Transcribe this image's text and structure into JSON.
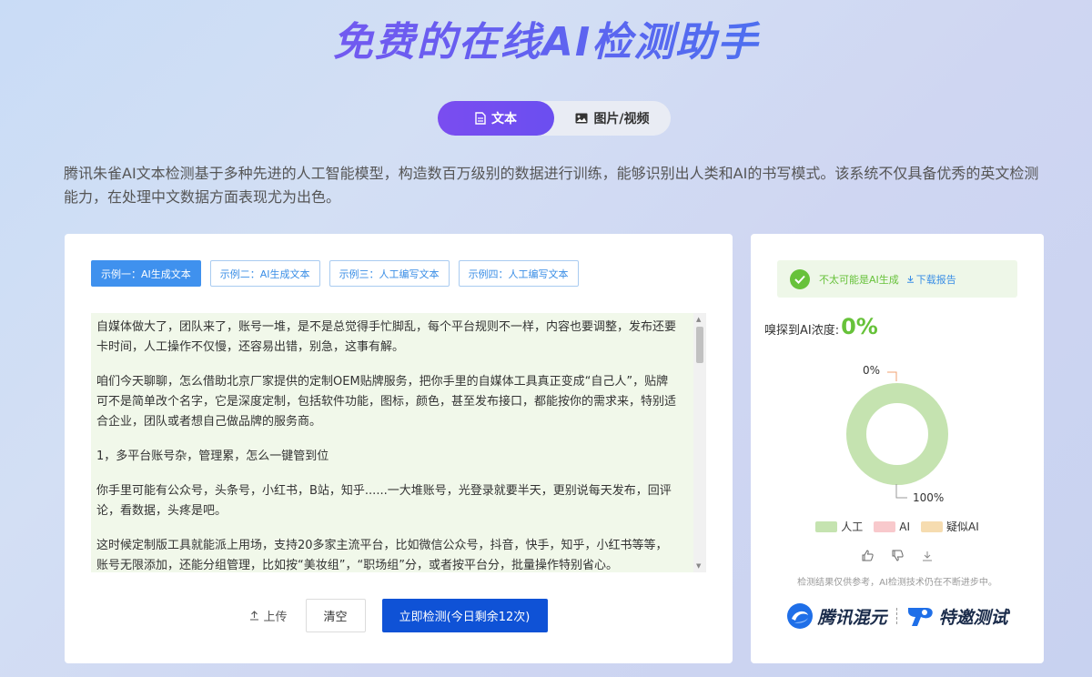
{
  "page_title": "免费的在线AI检测助手",
  "tabs": [
    {
      "label": "文本",
      "icon": "document-icon",
      "active": true
    },
    {
      "label": "图片/视频",
      "icon": "image-icon",
      "active": false
    }
  ],
  "description": "腾讯朱雀AI文本检测基于多种先进的人工智能模型，构造数百万级别的数据进行训练，能够识别出人类和AI的书写模式。该系统不仅具备优秀的英文检测能力，在处理中文数据方面表现尤为出色。",
  "examples": [
    {
      "label": "示例一：AI生成文本",
      "active": true
    },
    {
      "label": "示例二：AI生成文本",
      "active": false
    },
    {
      "label": "示例三：人工编写文本",
      "active": false
    },
    {
      "label": "示例四：人工编写文本",
      "active": false
    }
  ],
  "text_paragraphs": [
    "自媒体做大了，团队来了，账号一堆，是不是总觉得手忙脚乱，每个平台规则不一样，内容也要调整，发布还要卡时间，人工操作不仅慢，还容易出错，别急，这事有解。",
    "咱们今天聊聊，怎么借助北京厂家提供的定制OEM贴牌服务，把你手里的自媒体工具真正变成“自己人”，贴牌可不是简单改个名字，它是深度定制，包括软件功能，图标，颜色，甚至发布接口，都能按你的需求来，特别适合企业，团队或者想自己做品牌的服务商。",
    "1，多平台账号杂，管理累，怎么一键管到位",
    "你手里可能有公众号，头条号，小红书，B站，知乎......一大堆账号，光登录就要半天，更别说每天发布，回评论，看数据，头疼是吧。",
    "这时候定制版工具就能派上用场，支持20多家主流平台，比如微信公众号，抖音，快手，知乎，小红书等等，账号无限添加，还能分组管理，比如按“美妆组”，“职场组”分，或者按平台分，批量操作特别省心。"
  ],
  "actions": {
    "upload": "上传",
    "clear": "清空",
    "detect": "立即检测(今日剩余12次)"
  },
  "result": {
    "verdict": "不太可能是AI生成",
    "download": "下载报告",
    "density_label": "嗅探到AI浓度:",
    "density_value": "0%"
  },
  "chart_data": {
    "type": "pie",
    "categories": [
      "人工",
      "AI",
      "疑似AI"
    ],
    "values": [
      100,
      0,
      0
    ],
    "labels": [
      "0%",
      "100%"
    ],
    "colors": [
      "#c5e3b0",
      "#f8c9cc",
      "#f6dcb0"
    ]
  },
  "legend": [
    {
      "label": "人工",
      "color": "#c5e3b0"
    },
    {
      "label": "AI",
      "color": "#f8c9cc"
    },
    {
      "label": "疑似AI",
      "color": "#f6dcb0"
    }
  ],
  "disclaimer": "检测结果仅供参考，AI检测技术仍在不断进步中。",
  "brands": {
    "left": "腾讯混元",
    "right": "特邀测试"
  }
}
